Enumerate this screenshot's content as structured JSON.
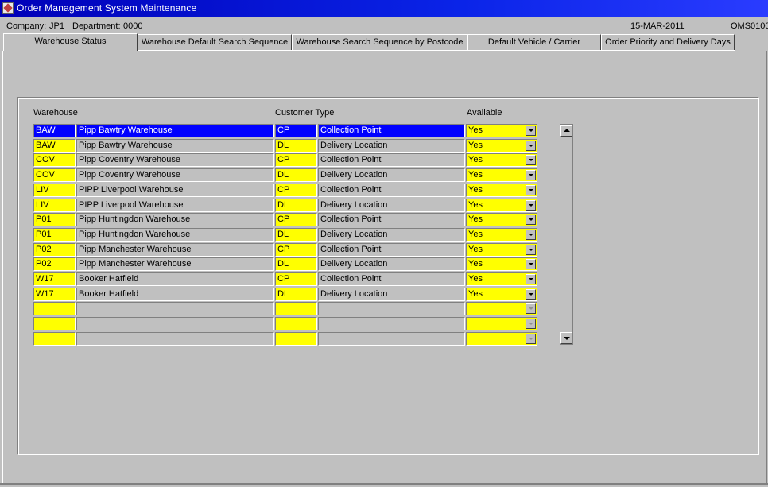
{
  "window": {
    "title": "Order Management System Maintenance"
  },
  "info": {
    "company_label": "Company:",
    "company": "JP1",
    "department_label": "Department:",
    "department": "0000",
    "date": "15-MAR-2011",
    "form_code": "OMS0100"
  },
  "tabs": [
    {
      "label": "Warehouse Status"
    },
    {
      "label": "Warehouse Default Search Sequence"
    },
    {
      "label": "Warehouse Search Sequence by Postcode"
    },
    {
      "label": "Default Vehicle / Carrier"
    },
    {
      "label": "Order Priority and Delivery Days"
    }
  ],
  "table": {
    "headers": {
      "warehouse": "Warehouse",
      "customer_type": "Customer Type",
      "available": "Available"
    },
    "rows": [
      {
        "code": "BAW",
        "name": "Pipp Bawtry Warehouse",
        "type": "CP",
        "type_desc": "Collection Point",
        "available": "Yes"
      },
      {
        "code": "BAW",
        "name": "Pipp Bawtry Warehouse",
        "type": "DL",
        "type_desc": "Delivery Location",
        "available": "Yes"
      },
      {
        "code": "COV",
        "name": "Pipp Coventry Warehouse",
        "type": "CP",
        "type_desc": "Collection Point",
        "available": "Yes"
      },
      {
        "code": "COV",
        "name": "Pipp Coventry Warehouse",
        "type": "DL",
        "type_desc": "Delivery Location",
        "available": "Yes"
      },
      {
        "code": "LIV",
        "name": "PIPP Liverpool Warehouse",
        "type": "CP",
        "type_desc": "Collection Point",
        "available": "Yes"
      },
      {
        "code": "LIV",
        "name": "PIPP Liverpool Warehouse",
        "type": "DL",
        "type_desc": "Delivery Location",
        "available": "Yes"
      },
      {
        "code": "P01",
        "name": "Pipp Huntingdon Warehouse",
        "type": "CP",
        "type_desc": "Collection Point",
        "available": "Yes"
      },
      {
        "code": "P01",
        "name": "Pipp Huntingdon Warehouse",
        "type": "DL",
        "type_desc": "Delivery Location",
        "available": "Yes"
      },
      {
        "code": "P02",
        "name": "Pipp Manchester Warehouse",
        "type": "CP",
        "type_desc": "Collection Point",
        "available": "Yes"
      },
      {
        "code": "P02",
        "name": "Pipp Manchester Warehouse",
        "type": "DL",
        "type_desc": "Delivery Location",
        "available": "Yes"
      },
      {
        "code": "W17",
        "name": "Booker Hatfield",
        "type": "CP",
        "type_desc": "Collection Point",
        "available": "Yes"
      },
      {
        "code": "W17",
        "name": "Booker Hatfield",
        "type": "DL",
        "type_desc": "Delivery Location",
        "available": "Yes"
      },
      {
        "code": "",
        "name": "",
        "type": "",
        "type_desc": "",
        "available": ""
      },
      {
        "code": "",
        "name": "",
        "type": "",
        "type_desc": "",
        "available": ""
      },
      {
        "code": "",
        "name": "",
        "type": "",
        "type_desc": "",
        "available": ""
      }
    ]
  },
  "colors": {
    "field_yellow": "#ffff00",
    "selection_blue": "#0000ff",
    "background_gray": "#c0c0c0"
  },
  "icons": {
    "app": "oracle-forms-app-icon",
    "combo": "chevron-down-icon",
    "scroll_up": "scroll-up-arrow-icon",
    "scroll_down": "scroll-down-arrow-icon"
  }
}
